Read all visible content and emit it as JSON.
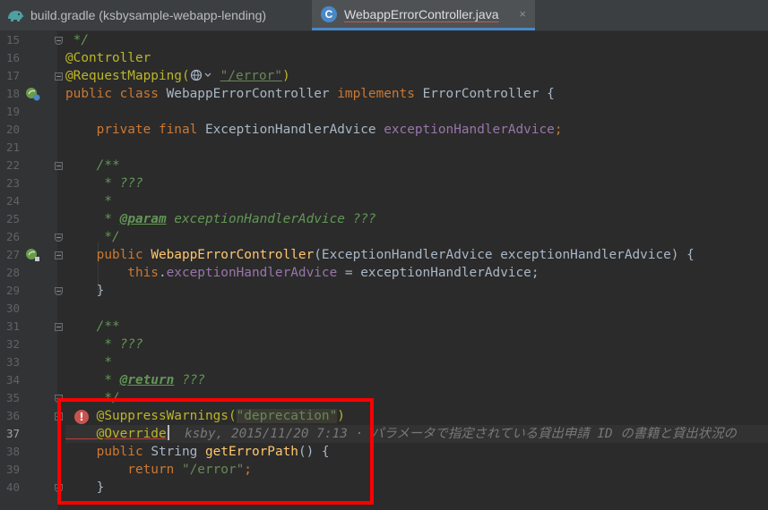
{
  "tabs": [
    {
      "label": "build.gradle (ksbysample-webapp-lending)",
      "icon": "gradle-elephant-icon",
      "active": false
    },
    {
      "label": "WebappErrorController.java",
      "icon": "java-class-icon",
      "icon_glyph": "C",
      "active": true,
      "close": "×"
    }
  ],
  "editor": {
    "line_numbers": [
      "15",
      "16",
      "17",
      "18",
      "19",
      "20",
      "21",
      "22",
      "23",
      "24",
      "25",
      "26",
      "27",
      "28",
      "29",
      "30",
      "31",
      "32",
      "33",
      "34",
      "35",
      "36",
      "37",
      "38",
      "39",
      "40"
    ],
    "current_line": "37",
    "code": {
      "l15": " */",
      "l16_ann": "@Controller",
      "l17_ann": "@RequestMapping(",
      "l17_str": "\"/error\"",
      "l17_close": ")",
      "l18_kw": "public class ",
      "l18_name": "WebappErrorController ",
      "l18_kw2": "implements ",
      "l18_iface": "ErrorController {",
      "l20_kw": "    private final ",
      "l20_type": "ExceptionHandlerAdvice ",
      "l20_field": "exceptionHandlerAdvice",
      "l20_semi": ";",
      "l22": "    /**",
      "l23": "     * ???",
      "l24": "     *",
      "l25_pre": "     * ",
      "l25_tag": "@param",
      "l25_rest": " exceptionHandlerAdvice ???",
      "l26": "     */",
      "l27_kw": "    public ",
      "l27_fn": "WebappErrorController",
      "l27_params": "(ExceptionHandlerAdvice exceptionHandlerAdvice) {",
      "l28_kw": "        this",
      "l28_dot": ".",
      "l28_field": "exceptionHandlerAdvice",
      "l28_rest": " = exceptionHandlerAdvice;",
      "l29": "    }",
      "l31": "    /**",
      "l32": "     * ???",
      "l33": "     *",
      "l34_pre": "     * ",
      "l34_tag": "@return",
      "l34_rest": " ???",
      "l35": "     */",
      "l36_ann": "    @SuppressWarnings(",
      "l36_str": "\"deprecation\"",
      "l36_close": ")",
      "l37_ann": "    @Override",
      "l37_blame": "  ksby, 2015/11/20 7:13 · パラメータで指定されている貸出申請 ID の書籍と貸出状況の",
      "l38_kw": "    public ",
      "l38_type": "String ",
      "l38_fn": "getErrorPath",
      "l38_rest": "() {",
      "l39_kw": "        return ",
      "l39_str": "\"/error\"",
      "l39_semi": ";",
      "l40": "    }"
    },
    "error_marker": "!"
  },
  "colors": {
    "keyword": "#cc7832",
    "annotation": "#bbb529",
    "string": "#6a8759",
    "field": "#9876aa",
    "method": "#ffc66d",
    "doc_comment": "#629755",
    "highlight_box": "#ff0000"
  }
}
